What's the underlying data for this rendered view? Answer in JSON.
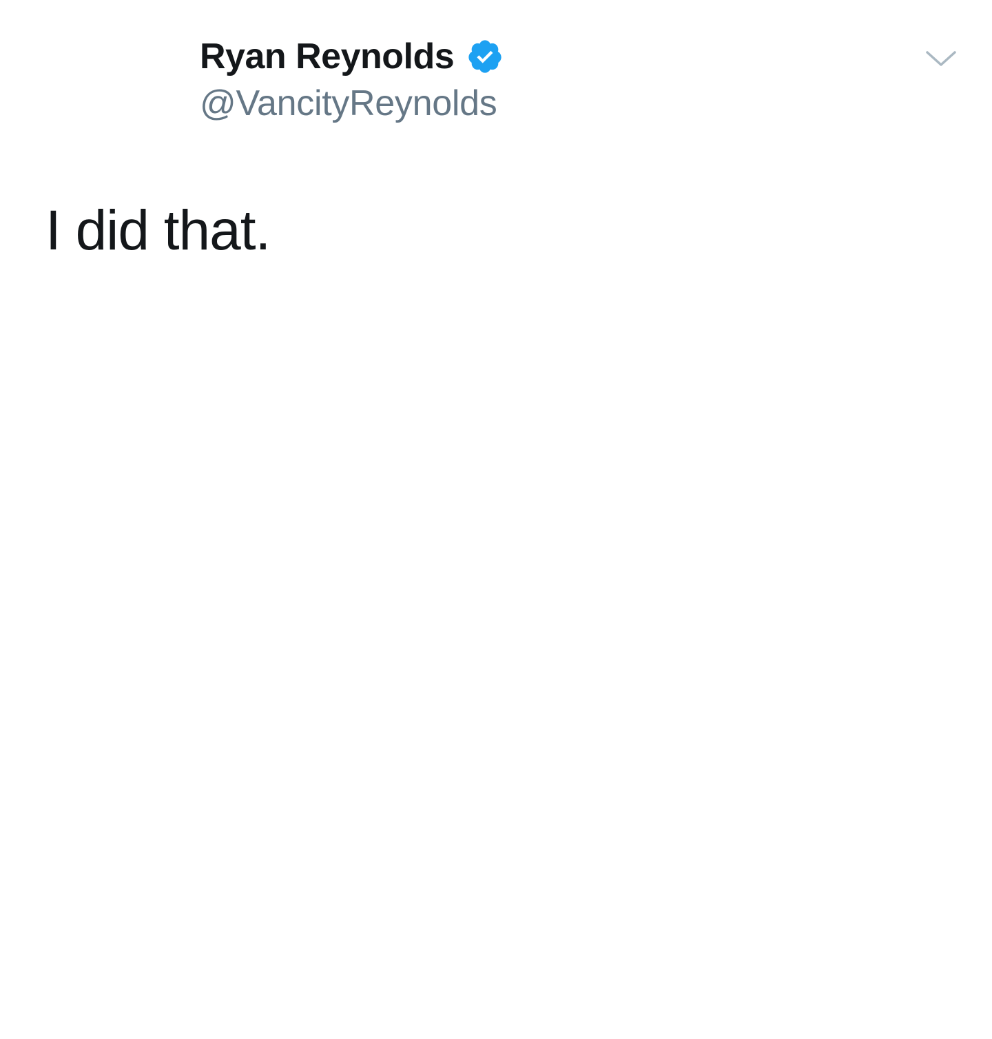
{
  "tweet": {
    "display_name": "Ryan Reynolds",
    "handle": "@VancityReynolds",
    "text": "I did that.",
    "verified": true
  },
  "icons": {
    "verified": "verified-badge-icon",
    "menu": "chevron-down-icon"
  },
  "colors": {
    "name": "#14171a",
    "handle": "#657786",
    "verified_badge": "#1da1f2",
    "chevron": "#aab8c2",
    "background": "#ffffff"
  }
}
